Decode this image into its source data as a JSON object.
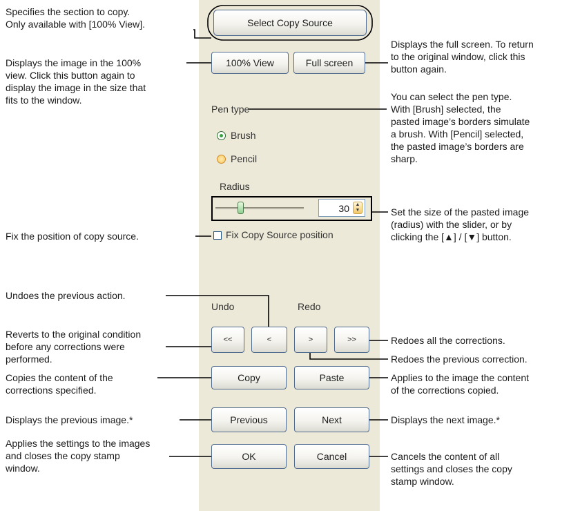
{
  "panel": {
    "select_copy_source": "Select Copy Source",
    "view_100": "100% View",
    "full_screen": "Full screen",
    "pen_type_label": "Pen type",
    "brush_label": "Brush",
    "pencil_label": "Pencil",
    "radius_label": "Radius",
    "radius_value": "30",
    "radius_slider_level": 0.2,
    "fix_source_label": "Fix Copy Source position",
    "undo_label": "Undo",
    "redo_label": "Redo",
    "btn_undo_all": "<<",
    "btn_undo": "<",
    "btn_redo": ">",
    "btn_redo_all": ">>",
    "copy": "Copy",
    "paste": "Paste",
    "previous": "Previous",
    "next": "Next",
    "ok": "OK",
    "cancel": "Cancel"
  },
  "annotations": {
    "select_source": [
      "Specifies the section to copy.",
      "Only available with [100% View]."
    ],
    "view_100": [
      "Displays the image in the 100%",
      "view. Click this button again to",
      "display the image in the size that",
      "fits to the window."
    ],
    "full_screen": [
      "Displays the full screen. To return",
      "to the original window, click this",
      "button again."
    ],
    "pen_type": [
      "You can select the pen type.",
      "With [Brush] selected, the",
      "pasted image’s borders simulate",
      "a brush. With [Pencil] selected,",
      "the pasted image’s borders are",
      "sharp."
    ],
    "radius": [
      "Set the size of the pasted image",
      "(radius) with the slider, or by",
      "clicking the [▲] / [▼] button."
    ],
    "fix_source": [
      "Fix the position of copy source."
    ],
    "undo": [
      "Undoes the previous action."
    ],
    "undo_all": [
      "Reverts to the original condition",
      "before any corrections were",
      "performed."
    ],
    "redo_all": [
      "Redoes all the corrections."
    ],
    "redo": [
      "Redoes the previous correction."
    ],
    "copy": [
      "Copies the content of the",
      "corrections specified."
    ],
    "paste": [
      "Applies to the image the content",
      "of the corrections copied."
    ],
    "previous": [
      "Displays the previous image.*"
    ],
    "next": [
      "Displays the next image.*"
    ],
    "ok": [
      "Applies the settings to the images",
      "and closes the copy stamp",
      "window."
    ],
    "cancel": [
      "Cancels the content of all",
      "settings and closes the copy",
      "stamp window."
    ]
  },
  "colors": {
    "panel_bg": "#ECE9D8",
    "button_border": "#4f6a8f",
    "radio_selected": "#3aa142",
    "radio_unselected": "#f7c95e"
  }
}
